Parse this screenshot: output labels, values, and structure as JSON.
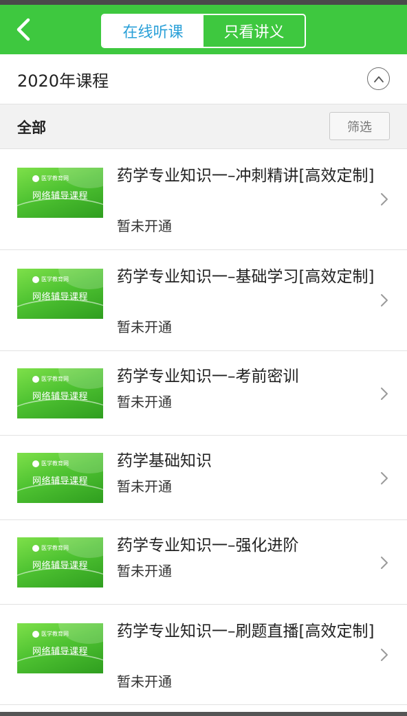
{
  "header": {
    "back_icon": "chevron-left-icon",
    "tabs": [
      {
        "label": "在线听课",
        "active": true
      },
      {
        "label": "只看讲义",
        "active": false
      }
    ],
    "color": "#3ec83f",
    "active_tab_text_color": "#2aa0d8"
  },
  "year_section": {
    "title": "2020年课程",
    "toggle_icon": "chevron-up-circle-icon"
  },
  "filter_bar": {
    "all_label": "全部",
    "filter_button_label": "筛选"
  },
  "course_thumbnail": {
    "logo_text": "医学教育网",
    "caption": "网络辅导课程"
  },
  "courses": [
    {
      "title": "药学专业知识一–冲刺精讲[高效定制]",
      "status": "暂未开通"
    },
    {
      "title": "药学专业知识一–基础学习[高效定制]",
      "status": "暂未开通"
    },
    {
      "title": "药学专业知识一–考前密训",
      "status": "暂未开通"
    },
    {
      "title": "药学基础知识",
      "status": "暂未开通"
    },
    {
      "title": "药学专业知识一–强化进阶",
      "status": "暂未开通"
    },
    {
      "title": "药学专业知识一–刷题直播[高效定制]",
      "status": "暂未开通"
    }
  ]
}
